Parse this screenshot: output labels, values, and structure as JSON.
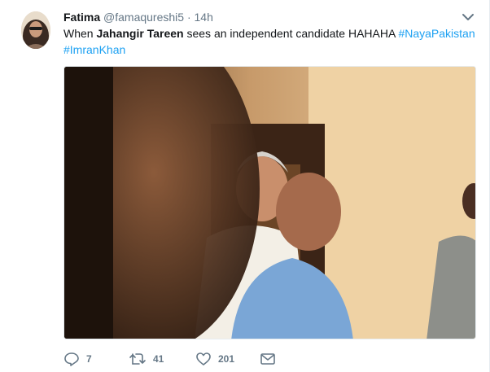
{
  "tweet": {
    "author_name": "Fatima",
    "author_handle": "@famaqureshi5",
    "separator": "·",
    "timestamp": "14h",
    "text_prefix": "When ",
    "text_bold": "Jahangir Tareen",
    "text_suffix": " sees an independent candidate HAHAHA ",
    "hashtag_1": "#NayaPakistan",
    "hashtag_2": "#ImranKhan"
  },
  "actions": {
    "reply_count": "7",
    "retweet_count": "41",
    "like_count": "201"
  },
  "colors": {
    "link": "#1da1f2",
    "muted": "#657786",
    "text": "#14171a"
  }
}
